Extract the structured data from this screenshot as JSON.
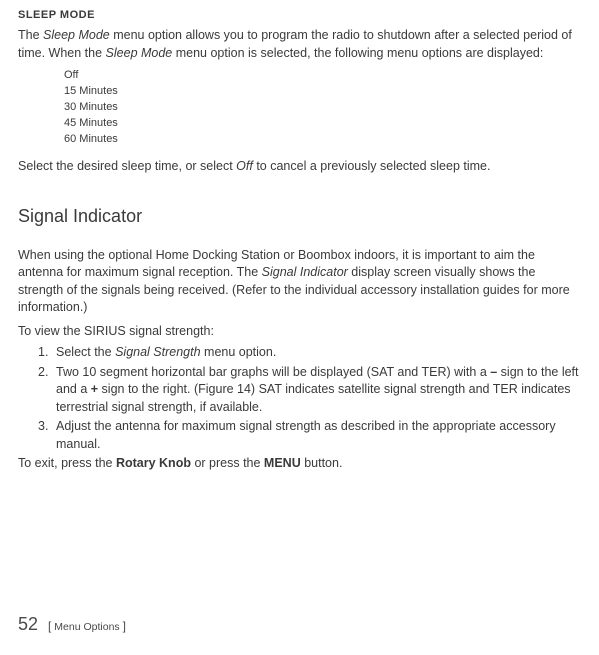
{
  "sleep": {
    "heading": "SLEEP MODE",
    "intro_part1": "The ",
    "intro_em1": "Sleep Mode",
    "intro_part2": " menu option allows you to program the radio to shutdown after a selected period of time. When the ",
    "intro_em2": "Sleep Mode",
    "intro_part3": " menu option is selected, the following menu options are displayed:",
    "options": [
      "Off",
      "15 Minutes",
      "30 Minutes",
      "45 Minutes",
      "60 Minutes"
    ],
    "outro_part1": "Select the desired sleep time, or select ",
    "outro_em": "Off",
    "outro_part2": " to cancel a previously selected sleep time."
  },
  "signal": {
    "heading": "Signal Indicator",
    "intro_part1": "When using the optional Home Docking Station or Boombox indoors, it is important to aim the antenna for maximum signal reception. The ",
    "intro_em": "Signal Indicator",
    "intro_part2": " display screen visually shows the strength of the signals being received. (Refer to the individual accessory installation guides for more information.)",
    "view_line": "To view the SIRIUS signal strength:",
    "steps": {
      "s1_a": "Select the ",
      "s1_em": "Signal Strength",
      "s1_b": " menu option.",
      "s2_a": "Two 10 segment horizontal bar graphs will be displayed (SAT and TER) with a ",
      "s2_b1": "–",
      "s2_c": " sign to the left and a ",
      "s2_b2": "+",
      "s2_d": " sign to the right. (Figure 14) SAT indicates satellite signal strength and TER indicates terrestrial signal strength, if available.",
      "s3": "Adjust the antenna for maximum signal strength as described in the appropriate accessory manual."
    },
    "exit_a": "To exit, press the ",
    "exit_b1": "Rotary Knob",
    "exit_b": " or press the ",
    "exit_b2": "MENU",
    "exit_c": " button."
  },
  "footer": {
    "page": "52",
    "bracket_open": "[",
    "label": " Menu Options ",
    "bracket_close": "]"
  }
}
